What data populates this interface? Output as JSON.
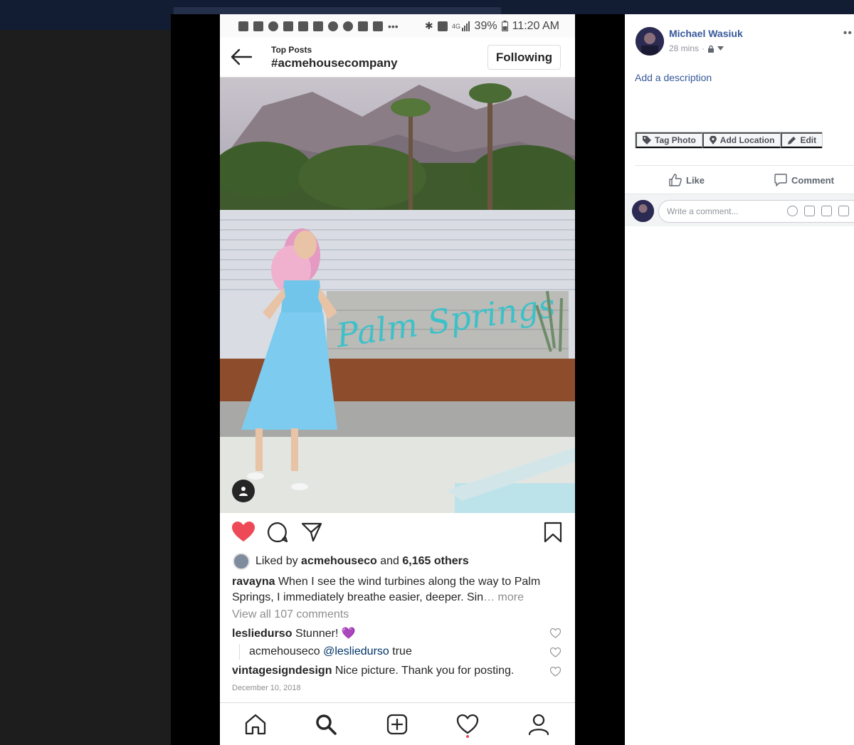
{
  "phone": {
    "status": {
      "battery": "39%",
      "time": "11:20 AM"
    },
    "header": {
      "subtitle": "Top Posts",
      "hashtag": "#acmehousecompany",
      "follow_button": "Following"
    },
    "post": {
      "liked_by_prefix": "Liked by",
      "liked_by_user": "acmehouseco",
      "liked_by_and": "and",
      "liked_by_others": "6,165 others",
      "caption_user": "ravayna",
      "caption_text": "When I see the wind turbines along the way to Palm Springs, I immediately breathe easier, deeper. Sin",
      "caption_more": "… more",
      "view_comments": "View all 107 comments",
      "comments": [
        {
          "user": "lesliedurso",
          "text": "Stunner! 💜"
        },
        {
          "user": "acmehouseco",
          "mention": "@lesliedurso",
          "text": "true"
        },
        {
          "user": "vintagesigndesign",
          "text": "Nice picture. Thank you for posting."
        }
      ],
      "date": "December 10, 2018"
    },
    "photo_sign_text": "Palm Springs"
  },
  "facebook": {
    "poster_name": "Michael Wasiuk",
    "post_time": "28 mins",
    "add_description": "Add a description",
    "tools": {
      "tag": "Tag Photo",
      "location": "Add Location",
      "edit": "Edit"
    },
    "like": "Like",
    "comment": "Comment",
    "comment_placeholder": "Write a comment..."
  },
  "colors": {
    "ig_heart": "#ed4956",
    "fb_link": "#365899"
  }
}
